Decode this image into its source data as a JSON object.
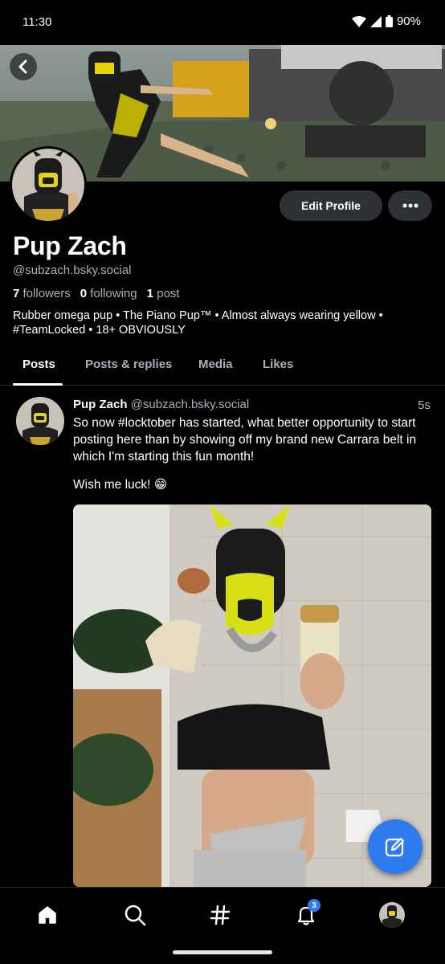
{
  "status_bar": {
    "time": "11:30",
    "battery": "90%"
  },
  "profile": {
    "name": "Pup Zach",
    "handle": "@subzach.bsky.social",
    "followers_count": "7",
    "followers_label": "followers",
    "following_count": "0",
    "following_label": "following",
    "posts_count": "1",
    "posts_label": "post",
    "bio": "Rubber omega pup • The Piano Pup™ • Almost always wearing yellow • #TeamLocked • 18+ OBVIOUSLY",
    "edit_label": "Edit Profile"
  },
  "tabs": [
    {
      "label": "Posts",
      "active": true
    },
    {
      "label": "Posts & replies",
      "active": false
    },
    {
      "label": "Media",
      "active": false
    },
    {
      "label": "Likes",
      "active": false
    }
  ],
  "post": {
    "author": "Pup Zach",
    "handle": "@subzach.bsky.social",
    "time": "5s",
    "text": "So now #locktober has started, what better opportunity to start posting here than by showing off my brand new Carrara belt in which I'm starting this fun month!",
    "text2": "Wish me luck! 😁"
  },
  "nav": {
    "notifications_badge": "3"
  },
  "colors": {
    "accent": "#2f7bf0",
    "background": "#000000",
    "muted_text": "#aab0ba",
    "button_bg": "#2e3136"
  }
}
